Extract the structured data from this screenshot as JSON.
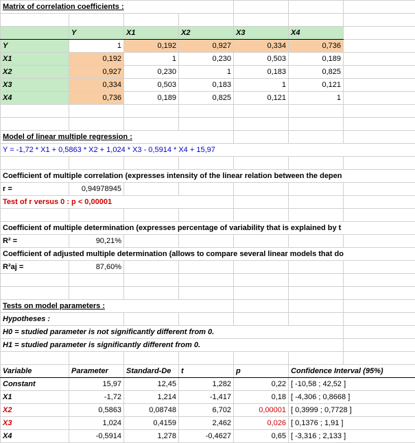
{
  "headers": {
    "matrix_title": "Matrix of correlation coefficients :",
    "model_title": "Model of linear multiple regression :",
    "model_formula": "Y = -1,72 * X1 + 0,5863 * X2 + 1,024 * X3 - 0,5914 * X4 + 15,97",
    "coef_mult_corr": "Coefficient of multiple correlation (expresses intensity of the linear relation between the depen",
    "r_label": "r =",
    "r_value": "0,94978945",
    "test_r": "Test of r versus 0 : p < 0,00001",
    "coef_mult_det": "Coefficient of multiple determination (expresses percentage of variability that is explained by t",
    "r2_label": "R² =",
    "r2_value": "90,21%",
    "coef_adj_det": "Coefficient of adjusted multiple determination (allows to compare several linear models that do",
    "r2aj_label": "R²aj =",
    "r2aj_value": "87,60%",
    "tests_title": "Tests on model parameters :",
    "hypotheses": "Hypotheses :",
    "h0": "H0 = studied parameter is not significantly different from 0.",
    "h1": "H1 = studied parameter is significantly different from 0."
  },
  "matrix": {
    "col_headers": [
      "Y",
      "X1",
      "X2",
      "X3",
      "X4"
    ],
    "rows": [
      {
        "label": "Y",
        "vals": [
          "1",
          "0,192",
          "0,927",
          "0,334",
          "0,736"
        ]
      },
      {
        "label": "X1",
        "vals": [
          "0,192",
          "1",
          "0,230",
          "0,503",
          "0,189"
        ]
      },
      {
        "label": "X2",
        "vals": [
          "0,927",
          "0,230",
          "1",
          "0,183",
          "0,825"
        ]
      },
      {
        "label": "X3",
        "vals": [
          "0,334",
          "0,503",
          "0,183",
          "1",
          "0,121"
        ]
      },
      {
        "label": "X4",
        "vals": [
          "0,736",
          "0,189",
          "0,825",
          "0,121",
          "1"
        ]
      }
    ]
  },
  "params": {
    "headers": [
      "Variable",
      "Parameter",
      "Standard-De",
      "t",
      "p",
      "Confidence Interval (95%)"
    ],
    "rows": [
      {
        "var": "Constant",
        "param": "15,97",
        "se": "12,45",
        "t": "1,282",
        "p": "0,22",
        "ci": "[ -10,58 ; 42,52 ]",
        "red_var": false,
        "red_p": false
      },
      {
        "var": "X1",
        "param": "-1,72",
        "se": "1,214",
        "t": "-1,417",
        "p": "0,18",
        "ci": "[ -4,306 ; 0,8668 ]",
        "red_var": false,
        "red_p": false
      },
      {
        "var": "X2",
        "param": "0,5863",
        "se": "0,08748",
        "t": "6,702",
        "p": "0,00001",
        "ci": "[ 0,3999 ; 0,7728 ]",
        "red_var": true,
        "red_p": true
      },
      {
        "var": "X3",
        "param": "1,024",
        "se": "0,4159",
        "t": "2,462",
        "p": "0,026",
        "ci": "[ 0,1376 ; 1,91 ]",
        "red_var": true,
        "red_p": true
      },
      {
        "var": "X4",
        "param": "-0,5914",
        "se": "1,278",
        "t": "-0,4627",
        "p": "0,65",
        "ci": "[ -3,316 ; 2,133 ]",
        "red_var": false,
        "red_p": false
      }
    ]
  },
  "chart_data": {
    "type": "table",
    "correlation_matrix": {
      "variables": [
        "Y",
        "X1",
        "X2",
        "X3",
        "X4"
      ],
      "values": [
        [
          1,
          0.192,
          0.927,
          0.334,
          0.736
        ],
        [
          0.192,
          1,
          0.23,
          0.503,
          0.189
        ],
        [
          0.927,
          0.23,
          1,
          0.183,
          0.825
        ],
        [
          0.334,
          0.503,
          0.183,
          1,
          0.121
        ],
        [
          0.736,
          0.189,
          0.825,
          0.121,
          1
        ]
      ]
    },
    "r": 0.94978945,
    "r2": 0.9021,
    "r2_adj": 0.876,
    "parameters": [
      {
        "variable": "Constant",
        "estimate": 15.97,
        "se": 12.45,
        "t": 1.282,
        "p": 0.22,
        "ci_low": -10.58,
        "ci_high": 42.52
      },
      {
        "variable": "X1",
        "estimate": -1.72,
        "se": 1.214,
        "t": -1.417,
        "p": 0.18,
        "ci_low": -4.306,
        "ci_high": 0.8668
      },
      {
        "variable": "X2",
        "estimate": 0.5863,
        "se": 0.08748,
        "t": 6.702,
        "p": 1e-05,
        "ci_low": 0.3999,
        "ci_high": 0.7728
      },
      {
        "variable": "X3",
        "estimate": 1.024,
        "se": 0.4159,
        "t": 2.462,
        "p": 0.026,
        "ci_low": 0.1376,
        "ci_high": 1.91
      },
      {
        "variable": "X4",
        "estimate": -0.5914,
        "se": 1.278,
        "t": -0.4627,
        "p": 0.65,
        "ci_low": -3.316,
        "ci_high": 2.133
      }
    ]
  }
}
